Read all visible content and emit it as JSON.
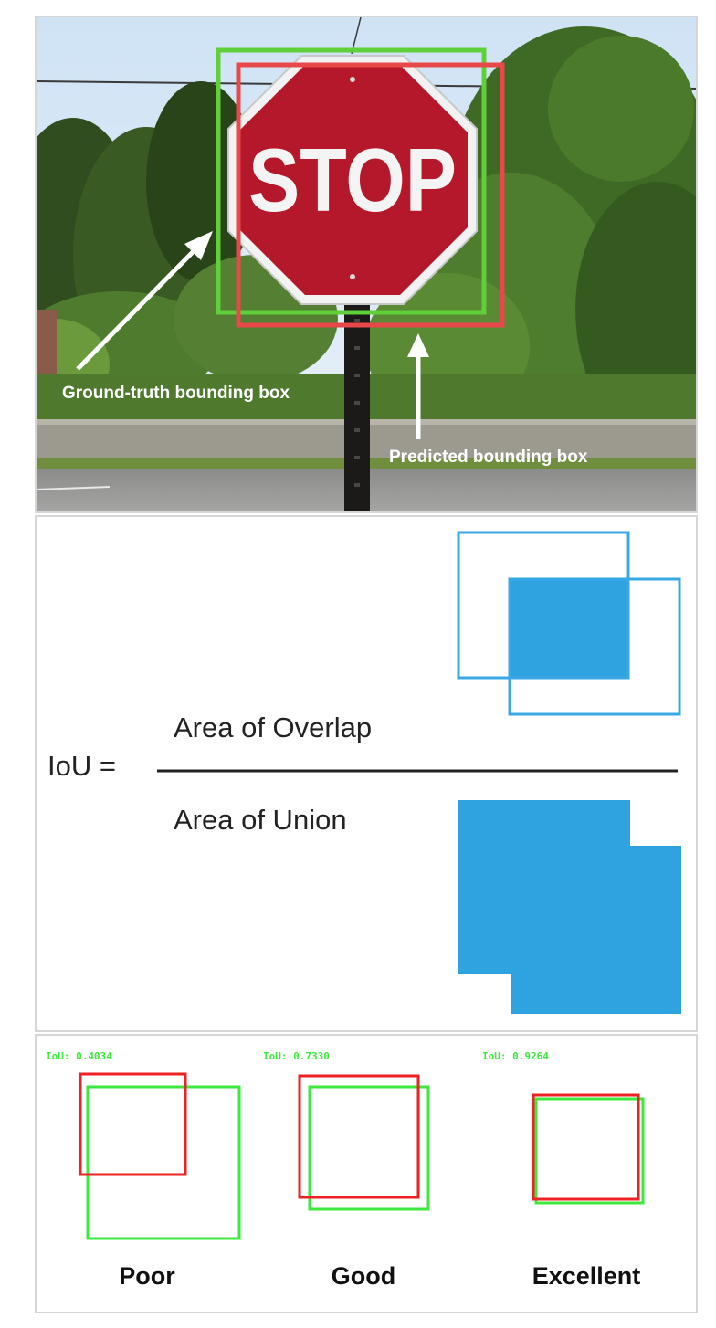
{
  "photo": {
    "sign_text": "STOP",
    "ground_truth_label": "Ground-truth bounding box",
    "predicted_label": "Predicted bounding box",
    "colors": {
      "ground_truth": "#5fcf3a",
      "predicted": "#e8484a",
      "sign": "#b5182a"
    }
  },
  "formula": {
    "lhs": "IoU =",
    "numerator": "Area of Overlap",
    "denominator": "Area of Union",
    "colors": {
      "fill": "#2fa2e0",
      "outline": "#38a8e6",
      "line": "#222222"
    }
  },
  "examples": [
    {
      "iou_label": "IoU: 0.4034",
      "rating": "Poor"
    },
    {
      "iou_label": "IoU: 0.7330",
      "rating": "Good"
    },
    {
      "iou_label": "IoU: 0.9264",
      "rating": "Excellent"
    }
  ],
  "example_colors": {
    "ground_truth": "#3ee83e",
    "predicted": "#ee2222"
  }
}
